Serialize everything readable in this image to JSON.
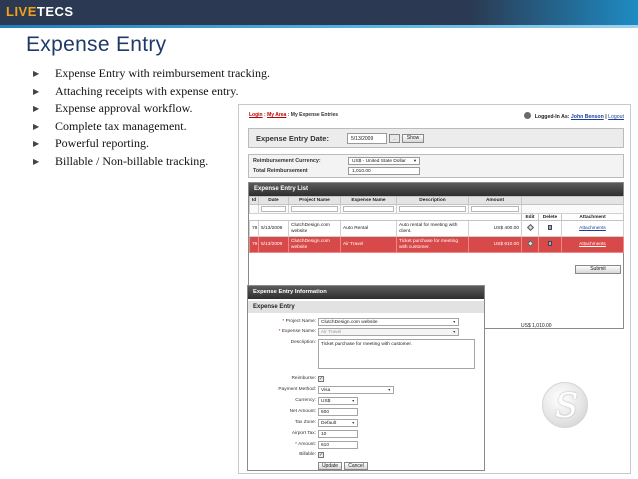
{
  "brand": {
    "logo_pre": "LIVE",
    "logo_post": "TECS"
  },
  "slide": {
    "title": "Expense Entry",
    "bullets": [
      "Expense Entry with reimbursement tracking.",
      "Attaching receipts with expense entry.",
      "Expense approval workflow.",
      "Complete tax management.",
      "Powerful reporting.",
      "Billable / Non-billable tracking."
    ]
  },
  "app": {
    "breadcrumb": {
      "login": "Login",
      "sep1": " : ",
      "my_area": "My Area",
      "sep2": " : ",
      "current": "My Expense Entries"
    },
    "logged_in": {
      "label": "Logged-In As:",
      "user": "John Benson",
      "logout": "Logout"
    },
    "date_bar": {
      "label": "Expense Entry Date:",
      "date": "5/13/2009",
      "picker": "...",
      "show": "Show"
    },
    "reimbursement_currency_label": "Reimbursement Currency:",
    "reimbursement_currency_value": "US$ - United State Dollar",
    "total_reimbursement_label": "Total Reimbursement",
    "total_reimbursement_value": "1,010.00",
    "list": {
      "title": "Expense Entry List",
      "headers": [
        "Id",
        "Date",
        "Project Name",
        "Expense Name",
        "Description",
        "Amount"
      ],
      "action_headers": [
        "Edit",
        "Delete",
        "Attachment"
      ],
      "rows": [
        {
          "id": "78",
          "date": "5/13/2009",
          "project": "ClutchDesign.com website",
          "expense": "Auto Rental",
          "description": "Auto rental for meeting with client.",
          "amount": "US$ 400.00",
          "attachment": "Attachments"
        },
        {
          "id": "79",
          "date": "5/13/2009",
          "project": "ClutchDesign.com website",
          "expense": "Air Travel",
          "description": "Ticket purchase for meeting with customer.",
          "amount": "US$ 610.00",
          "attachment": "Attachments"
        }
      ],
      "total": "US$ 1,010.00",
      "submit": "Submit"
    },
    "info": {
      "title": "Expense Entry Information",
      "section": "Expense Entry",
      "labels": {
        "project_name": "Project Name:",
        "expense_name": "Expense Name:",
        "description": "Description:",
        "reimburse": "Reimburse:",
        "payment_method": "Payment Method:",
        "currency": "Currency:",
        "net_amount": "Net Amount:",
        "tax_zone": "Tax Zone:",
        "airport_tax": "Airport Tax:",
        "amount": "Amount:",
        "billable": "Billable:"
      },
      "required_mark": "*",
      "values": {
        "project_name": "ClutchDesign.com website",
        "expense_name": "Air Travel",
        "description": "Ticket purchase for meeting with customer.",
        "payment_method": "Visa",
        "currency": "US$",
        "net_amount": "600",
        "tax_zone": "Default",
        "airport_tax": "10",
        "amount": "610"
      },
      "update": "Update",
      "cancel": "Cancel"
    }
  },
  "colors": {
    "header_dark": "#2b3a52",
    "accent_orange": "#f0a21a",
    "title_blue": "#1f3a68",
    "selected_row": "#d8494a"
  }
}
